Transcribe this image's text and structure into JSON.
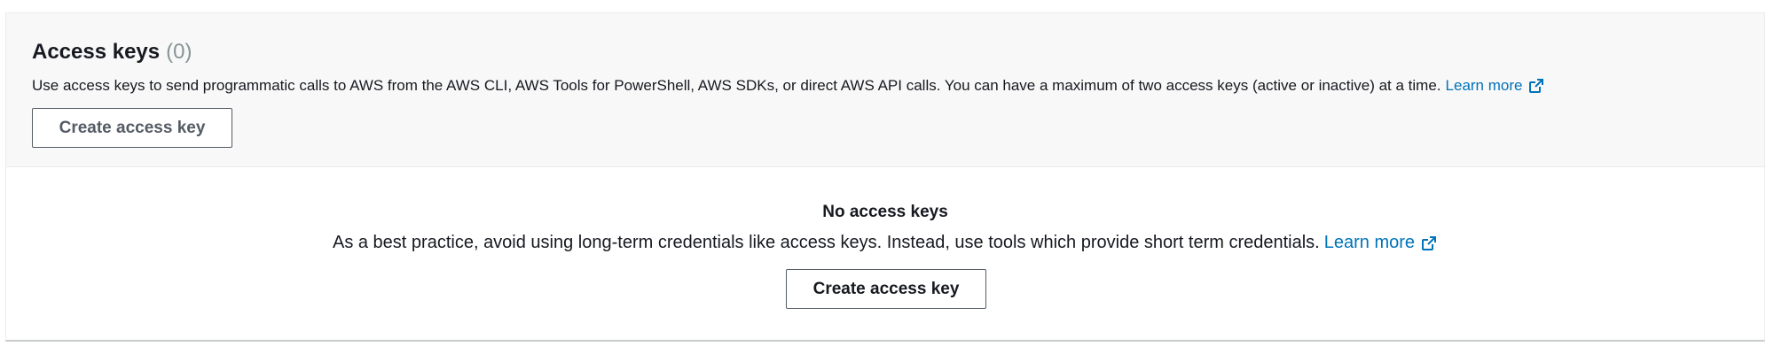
{
  "panel": {
    "title": "Access keys",
    "count": "(0)",
    "description": "Use access keys to send programmatic calls to AWS from the AWS CLI, AWS Tools for PowerShell, AWS SDKs, or direct AWS API calls. You can have a maximum of two access keys (active or inactive) at a time.",
    "learn_more": "Learn more",
    "create_button": "Create access key"
  },
  "empty_state": {
    "title": "No access keys",
    "description": "As a best practice, avoid using long-term credentials like access keys. Instead, use tools which provide short term credentials.",
    "learn_more": "Learn more",
    "create_button": "Create access key"
  },
  "icons": {
    "external_link": "external-link-icon"
  },
  "colors": {
    "link": "#0073bb",
    "header_bg": "#f8f8f8",
    "count_gray": "#879596",
    "button_border": "#545b64"
  }
}
